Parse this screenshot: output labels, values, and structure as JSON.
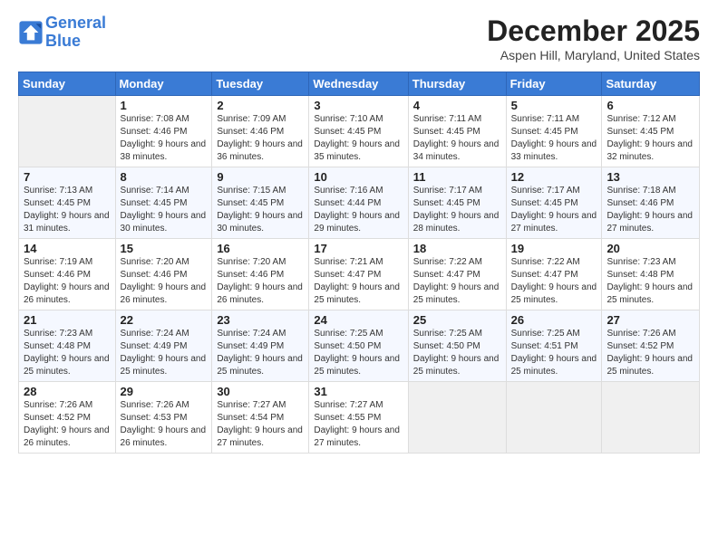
{
  "logo": {
    "line1": "General",
    "line2": "Blue"
  },
  "title": "December 2025",
  "location": "Aspen Hill, Maryland, United States",
  "weekdays": [
    "Sunday",
    "Monday",
    "Tuesday",
    "Wednesday",
    "Thursday",
    "Friday",
    "Saturday"
  ],
  "weeks": [
    [
      {
        "day": "",
        "sunrise": "",
        "sunset": "",
        "daylight": ""
      },
      {
        "day": "1",
        "sunrise": "Sunrise: 7:08 AM",
        "sunset": "Sunset: 4:46 PM",
        "daylight": "Daylight: 9 hours and 38 minutes."
      },
      {
        "day": "2",
        "sunrise": "Sunrise: 7:09 AM",
        "sunset": "Sunset: 4:46 PM",
        "daylight": "Daylight: 9 hours and 36 minutes."
      },
      {
        "day": "3",
        "sunrise": "Sunrise: 7:10 AM",
        "sunset": "Sunset: 4:45 PM",
        "daylight": "Daylight: 9 hours and 35 minutes."
      },
      {
        "day": "4",
        "sunrise": "Sunrise: 7:11 AM",
        "sunset": "Sunset: 4:45 PM",
        "daylight": "Daylight: 9 hours and 34 minutes."
      },
      {
        "day": "5",
        "sunrise": "Sunrise: 7:11 AM",
        "sunset": "Sunset: 4:45 PM",
        "daylight": "Daylight: 9 hours and 33 minutes."
      },
      {
        "day": "6",
        "sunrise": "Sunrise: 7:12 AM",
        "sunset": "Sunset: 4:45 PM",
        "daylight": "Daylight: 9 hours and 32 minutes."
      }
    ],
    [
      {
        "day": "7",
        "sunrise": "Sunrise: 7:13 AM",
        "sunset": "Sunset: 4:45 PM",
        "daylight": "Daylight: 9 hours and 31 minutes."
      },
      {
        "day": "8",
        "sunrise": "Sunrise: 7:14 AM",
        "sunset": "Sunset: 4:45 PM",
        "daylight": "Daylight: 9 hours and 30 minutes."
      },
      {
        "day": "9",
        "sunrise": "Sunrise: 7:15 AM",
        "sunset": "Sunset: 4:45 PM",
        "daylight": "Daylight: 9 hours and 30 minutes."
      },
      {
        "day": "10",
        "sunrise": "Sunrise: 7:16 AM",
        "sunset": "Sunset: 4:44 PM",
        "daylight": "Daylight: 9 hours and 29 minutes."
      },
      {
        "day": "11",
        "sunrise": "Sunrise: 7:17 AM",
        "sunset": "Sunset: 4:45 PM",
        "daylight": "Daylight: 9 hours and 28 minutes."
      },
      {
        "day": "12",
        "sunrise": "Sunrise: 7:17 AM",
        "sunset": "Sunset: 4:45 PM",
        "daylight": "Daylight: 9 hours and 27 minutes."
      },
      {
        "day": "13",
        "sunrise": "Sunrise: 7:18 AM",
        "sunset": "Sunset: 4:46 PM",
        "daylight": "Daylight: 9 hours and 27 minutes."
      }
    ],
    [
      {
        "day": "14",
        "sunrise": "Sunrise: 7:19 AM",
        "sunset": "Sunset: 4:46 PM",
        "daylight": "Daylight: 9 hours and 26 minutes."
      },
      {
        "day": "15",
        "sunrise": "Sunrise: 7:20 AM",
        "sunset": "Sunset: 4:46 PM",
        "daylight": "Daylight: 9 hours and 26 minutes."
      },
      {
        "day": "16",
        "sunrise": "Sunrise: 7:20 AM",
        "sunset": "Sunset: 4:46 PM",
        "daylight": "Daylight: 9 hours and 26 minutes."
      },
      {
        "day": "17",
        "sunrise": "Sunrise: 7:21 AM",
        "sunset": "Sunset: 4:47 PM",
        "daylight": "Daylight: 9 hours and 25 minutes."
      },
      {
        "day": "18",
        "sunrise": "Sunrise: 7:22 AM",
        "sunset": "Sunset: 4:47 PM",
        "daylight": "Daylight: 9 hours and 25 minutes."
      },
      {
        "day": "19",
        "sunrise": "Sunrise: 7:22 AM",
        "sunset": "Sunset: 4:47 PM",
        "daylight": "Daylight: 9 hours and 25 minutes."
      },
      {
        "day": "20",
        "sunrise": "Sunrise: 7:23 AM",
        "sunset": "Sunset: 4:48 PM",
        "daylight": "Daylight: 9 hours and 25 minutes."
      }
    ],
    [
      {
        "day": "21",
        "sunrise": "Sunrise: 7:23 AM",
        "sunset": "Sunset: 4:48 PM",
        "daylight": "Daylight: 9 hours and 25 minutes."
      },
      {
        "day": "22",
        "sunrise": "Sunrise: 7:24 AM",
        "sunset": "Sunset: 4:49 PM",
        "daylight": "Daylight: 9 hours and 25 minutes."
      },
      {
        "day": "23",
        "sunrise": "Sunrise: 7:24 AM",
        "sunset": "Sunset: 4:49 PM",
        "daylight": "Daylight: 9 hours and 25 minutes."
      },
      {
        "day": "24",
        "sunrise": "Sunrise: 7:25 AM",
        "sunset": "Sunset: 4:50 PM",
        "daylight": "Daylight: 9 hours and 25 minutes."
      },
      {
        "day": "25",
        "sunrise": "Sunrise: 7:25 AM",
        "sunset": "Sunset: 4:50 PM",
        "daylight": "Daylight: 9 hours and 25 minutes."
      },
      {
        "day": "26",
        "sunrise": "Sunrise: 7:25 AM",
        "sunset": "Sunset: 4:51 PM",
        "daylight": "Daylight: 9 hours and 25 minutes."
      },
      {
        "day": "27",
        "sunrise": "Sunrise: 7:26 AM",
        "sunset": "Sunset: 4:52 PM",
        "daylight": "Daylight: 9 hours and 25 minutes."
      }
    ],
    [
      {
        "day": "28",
        "sunrise": "Sunrise: 7:26 AM",
        "sunset": "Sunset: 4:52 PM",
        "daylight": "Daylight: 9 hours and 26 minutes."
      },
      {
        "day": "29",
        "sunrise": "Sunrise: 7:26 AM",
        "sunset": "Sunset: 4:53 PM",
        "daylight": "Daylight: 9 hours and 26 minutes."
      },
      {
        "day": "30",
        "sunrise": "Sunrise: 7:27 AM",
        "sunset": "Sunset: 4:54 PM",
        "daylight": "Daylight: 9 hours and 27 minutes."
      },
      {
        "day": "31",
        "sunrise": "Sunrise: 7:27 AM",
        "sunset": "Sunset: 4:55 PM",
        "daylight": "Daylight: 9 hours and 27 minutes."
      },
      {
        "day": "",
        "sunrise": "",
        "sunset": "",
        "daylight": ""
      },
      {
        "day": "",
        "sunrise": "",
        "sunset": "",
        "daylight": ""
      },
      {
        "day": "",
        "sunrise": "",
        "sunset": "",
        "daylight": ""
      }
    ]
  ]
}
